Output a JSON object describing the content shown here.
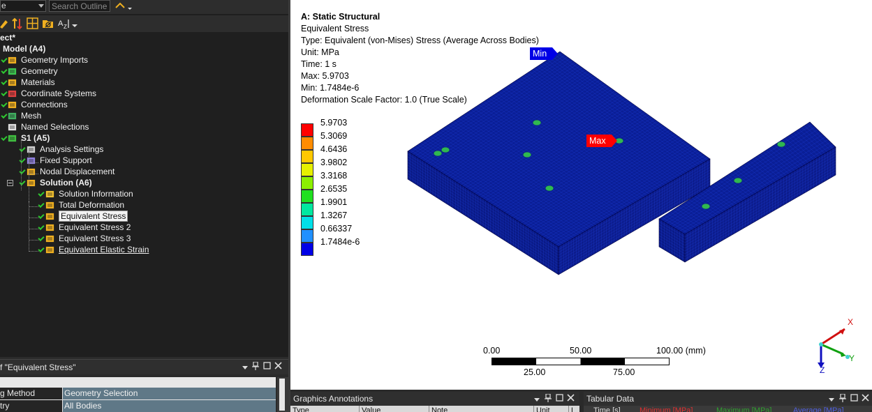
{
  "outline": {
    "filter_value": "e",
    "search_placeholder": "Search Outline",
    "project_label": "ect*",
    "tree": [
      {
        "label": "Model (A4)",
        "bold": true
      },
      {
        "label": "Geometry Imports"
      },
      {
        "label": "Geometry"
      },
      {
        "label": "Materials"
      },
      {
        "label": "Coordinate Systems"
      },
      {
        "label": "Connections"
      },
      {
        "label": "Mesh"
      },
      {
        "label": "Named Selections"
      },
      {
        "label": "S1 (A5)",
        "bold": true
      },
      {
        "label": "Analysis Settings"
      },
      {
        "label": "Fixed Support"
      },
      {
        "label": "Nodal Displacement"
      },
      {
        "label": "Solution (A6)",
        "bold": true
      },
      {
        "label": "Solution Information"
      },
      {
        "label": "Total Deformation"
      },
      {
        "label": "Equivalent Stress",
        "selected": true
      },
      {
        "label": "Equivalent Stress 2"
      },
      {
        "label": "Equivalent Stress 3"
      },
      {
        "label": "Equivalent Elastic Strain",
        "underline": true
      }
    ]
  },
  "details": {
    "title": "f \"Equivalent Stress\"",
    "rows": [
      {
        "key": "g Method",
        "value": "Geometry Selection"
      },
      {
        "key": "try",
        "value": "All Bodies"
      }
    ]
  },
  "viewport": {
    "info": {
      "title": "A: Static Structural",
      "result": "Equivalent Stress",
      "type": "Type: Equivalent (von-Mises) Stress (Average Across Bodies)",
      "unit": "Unit: MPa",
      "time": "Time: 1 s",
      "max": "Max: 5.9703",
      "min": "Min: 1.7484e-6",
      "scale_factor": "Deformation Scale Factor: 1.0 (True Scale)"
    },
    "legend": [
      {
        "label": "5.9703",
        "color": "#ff0000"
      },
      {
        "label": "5.3069",
        "color": "#ff8c00"
      },
      {
        "label": "4.6436",
        "color": "#ffc800"
      },
      {
        "label": "3.9802",
        "color": "#e6f000"
      },
      {
        "label": "3.3168",
        "color": "#8cf000"
      },
      {
        "label": "2.6535",
        "color": "#20e020"
      },
      {
        "label": "1.9901",
        "color": "#00e8a0"
      },
      {
        "label": "1.3267",
        "color": "#00e0e8"
      },
      {
        "label": "0.66337",
        "color": "#2090ff"
      },
      {
        "label": "1.7484e-6",
        "color": "#0000e6"
      }
    ],
    "probe_min": "Min",
    "probe_max": "Max",
    "scale_bar": {
      "top_labels": [
        "0.00",
        "50.00",
        "100.00 (mm)"
      ],
      "bottom_labels": [
        "25.00",
        "75.00"
      ]
    },
    "triad": {
      "x": "X",
      "y": "Y",
      "z": "Z"
    },
    "colors": {
      "model": "#0a1e96",
      "max_probe": "#ff0000",
      "min_probe": "#0000e6"
    }
  },
  "graphics_annotations": {
    "title": "Graphics Annotations",
    "columns": [
      "Type",
      "Value",
      "Note",
      "Unit",
      "L"
    ]
  },
  "tabular_data": {
    "title": "Tabular Data",
    "columns": [
      "Time [s]",
      "Minimum [MPa]",
      "Maximum [MPa]",
      "Average [MPa]"
    ]
  }
}
